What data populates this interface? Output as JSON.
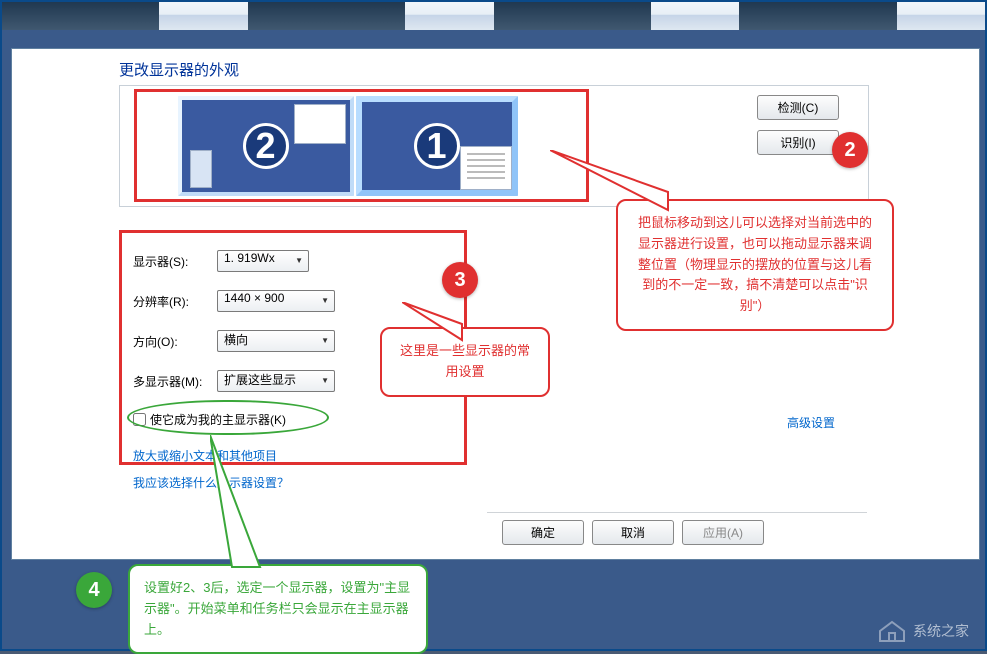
{
  "heading": "更改显示器的外观",
  "monitors": {
    "left_number": "2",
    "right_number": "1"
  },
  "buttons": {
    "detect": "检测(C)",
    "identify": "识别(I)",
    "ok": "确定",
    "cancel": "取消",
    "apply": "应用(A)"
  },
  "form": {
    "display_label": "显示器(S):",
    "display_value": "1. 919Wx",
    "resolution_label": "分辨率(R):",
    "resolution_value": "1440 × 900",
    "orientation_label": "方向(O):",
    "orientation_value": "横向",
    "multi_label": "多显示器(M):",
    "multi_value": "扩展这些显示",
    "primary_checkbox": "使它成为我的主显示器(K)"
  },
  "links": {
    "text_scaling": "放大或缩小文本和其他项目",
    "which_settings": "我应该选择什么显示器设置？",
    "advanced": "高级设置"
  },
  "annotations": {
    "badge2": "2",
    "badge3": "3",
    "badge4": "4",
    "callout2": "把鼠标移动到这儿可以选择对当前选中的显示器进行设置，也可以拖动显示器来调整位置（物理显示的摆放的位置与这儿看到的不一定一致，搞不清楚可以点击\"识别\"）",
    "callout3": "这里是一些显示器的常用设置",
    "callout4": "设置好2、3后，选定一个显示器，设置为\"主显示器\"。开始菜单和任务栏只会显示在主显示器上。"
  },
  "watermark": "系统之家"
}
